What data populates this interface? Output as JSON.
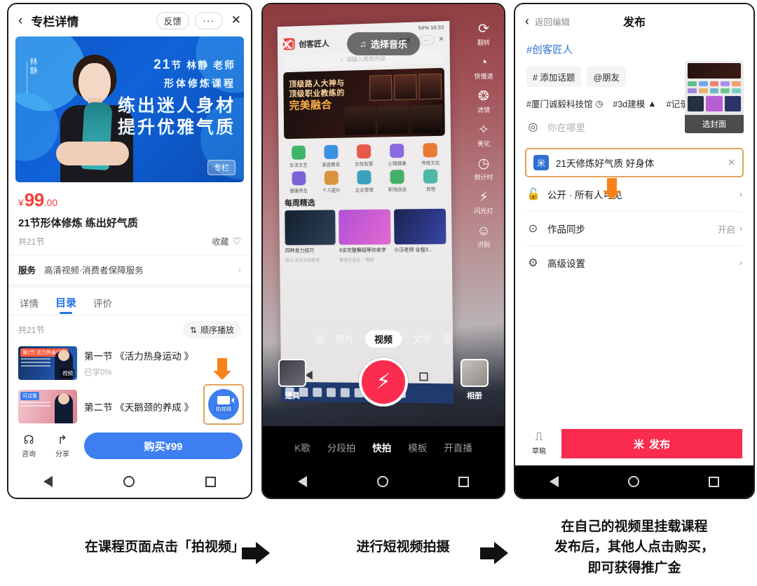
{
  "phone1": {
    "header": {
      "back": "‹",
      "title": "专栏详情",
      "feedback": "反馈",
      "more": "···",
      "close": "✕"
    },
    "banner": {
      "side_name": "林静",
      "line1_num": "21",
      "line1_rest": "节 林静 老师",
      "line2": "形体修炼课程",
      "headline1": "练出迷人身材",
      "headline2": "提升优雅气质",
      "tag": "专栏"
    },
    "price": {
      "currency": "¥",
      "amount": "99",
      "cents": ".00"
    },
    "course_title": "21节形体修炼 练出好气质",
    "lesson_count": "共21节",
    "favorite": "收藏",
    "service": {
      "label": "服务",
      "value": "高清视频·消费者保障服务"
    },
    "tabs": [
      {
        "label": "详情",
        "active": false
      },
      {
        "label": "目录",
        "active": true
      },
      {
        "label": "评价",
        "active": false
      }
    ],
    "list_count": "共21节",
    "order_btn": "顺序播放",
    "lessons": [
      {
        "title": "第一节 《活力热身运动 》",
        "progress": "已学0%",
        "badge": "第1节 活力热身运动",
        "tag": "视频"
      },
      {
        "title": "第二节 《天鹅颈的养成 》",
        "progress": "",
        "badge": "可试看",
        "tag": ""
      }
    ],
    "record_button": {
      "label": "拍视频"
    },
    "bottom": {
      "consult": "咨询",
      "share": "分享",
      "buy": "购买¥99"
    }
  },
  "phone2": {
    "close": "✕",
    "music": "选择音乐",
    "music_icon": "♫",
    "side_tools": [
      {
        "label": "翻转",
        "icon": "flip-icon"
      },
      {
        "label": "快慢速",
        "icon": "speed-icon"
      },
      {
        "label": "滤镜",
        "icon": "filter-icon"
      },
      {
        "label": "美化",
        "icon": "beautify-icon"
      },
      {
        "label": "倒计时",
        "icon": "timer-icon"
      },
      {
        "label": "闪光灯",
        "icon": "flash-icon"
      },
      {
        "label": "识别",
        "icon": "recognize-icon"
      }
    ],
    "inner_screen": {
      "status": "54%  16:33",
      "brand": "创客匠人",
      "feedback": "反馈",
      "more": "···",
      "close": "✕",
      "search_placeholder": "请输入搜索内容",
      "hero_line1": "顶级路人大神与",
      "hero_line2": "顶级职业教练的",
      "hero_line3": "完美融合",
      "categories": [
        {
          "label": "生活文艺",
          "color": "#3fb56a"
        },
        {
          "label": "家庭教育",
          "color": "#3d8fe0"
        },
        {
          "label": "女性智慧",
          "color": "#e8584a"
        },
        {
          "label": "心理健康",
          "color": "#8a6ae0"
        },
        {
          "label": "传统文化",
          "color": "#e87a36"
        },
        {
          "label": "健康养生",
          "color": "#7b61d8"
        },
        {
          "label": "个人提升",
          "color": "#d9933b"
        },
        {
          "label": "企业管理",
          "color": "#3aa2bd"
        },
        {
          "label": "职场创业",
          "color": "#46b06a"
        },
        {
          "label": "其他",
          "color": "#4fb7a8"
        }
      ],
      "section_title": "每周精选",
      "cards": [
        {
          "title": "四种发力技巧",
          "meta": "明点·东亚台球教室",
          "cover": "#1b2b3e"
        },
        {
          "title": "8支完整舞蹈等你来学",
          "meta": "舞者在身边 ｜舞蹈",
          "cover": "#b84fd8"
        },
        {
          "title": "小汪老师 全程3...",
          "meta": "",
          "cover": "#1c2550"
        }
      ],
      "tabs": [
        {
          "label": "图"
        },
        {
          "label": "照片"
        },
        {
          "label": "视频"
        },
        {
          "label": "文字"
        },
        {
          "label": "语"
        }
      ]
    },
    "modes": [
      {
        "label": "图",
        "selected": false
      },
      {
        "label": "照片",
        "selected": false
      },
      {
        "label": "视频",
        "selected": true
      },
      {
        "label": "文字",
        "selected": false
      },
      {
        "label": "语",
        "selected": false
      }
    ],
    "props_label": "道具",
    "album_label": "相册",
    "shutter_icon": "⚡",
    "bottom_tabs": [
      {
        "label": "K歌",
        "selected": false
      },
      {
        "label": "分段拍",
        "selected": false
      },
      {
        "label": "快拍",
        "selected": true
      },
      {
        "label": "模板",
        "selected": false
      },
      {
        "label": "开直播",
        "selected": false
      }
    ]
  },
  "phone3": {
    "header": {
      "back": "‹",
      "back_text": "返回编辑",
      "title": "发布"
    },
    "caption": "#创客匠人",
    "cover": {
      "label": "选封面"
    },
    "chips": [
      {
        "label": "# 添加话题"
      },
      {
        "label": "@朋友"
      }
    ],
    "suggested_tags": [
      {
        "label": "#厦门诚毅科技馆",
        "icon": "clock-icon"
      },
      {
        "label": "#3d建模",
        "icon": "fire-icon"
      },
      {
        "label": "#记录美好童年",
        "icon": ""
      }
    ],
    "rows": [
      {
        "icon": "location-icon",
        "label": "你在哪里",
        "placeholder": true,
        "right": "",
        "chevron": "›"
      },
      {
        "icon": "lock-icon",
        "label": "公开 · 所有人可见",
        "placeholder": false,
        "right": "",
        "chevron": "›"
      },
      {
        "icon": "sync-icon",
        "label": "作品同步",
        "placeholder": false,
        "right": "开启",
        "chevron": "›"
      },
      {
        "icon": "settings-icon",
        "label": "高级设置",
        "placeholder": false,
        "right": "",
        "chevron": "›"
      }
    ],
    "course_attach": {
      "icon": "米",
      "title": "21天修炼好气质 好身体",
      "close": "✕"
    },
    "bottom": {
      "draft": "草稿",
      "publish": "发布",
      "publish_icon": "米"
    }
  },
  "captions": {
    "step1": "在课程页面点击「拍视频」",
    "step2": "进行短视频拍摄",
    "step3_line1": "在自己的视频里挂载课程",
    "step3_line2": "发布后，其他人点击购买，",
    "step3_line3": "即可获得推广金"
  },
  "colors": {
    "brand_blue": "#3d7ef0",
    "accent_red": "#fb2c4f",
    "price_red": "#f5413b",
    "highlight_orange": "#e2a45b",
    "arrow_orange": "#f7821b"
  }
}
